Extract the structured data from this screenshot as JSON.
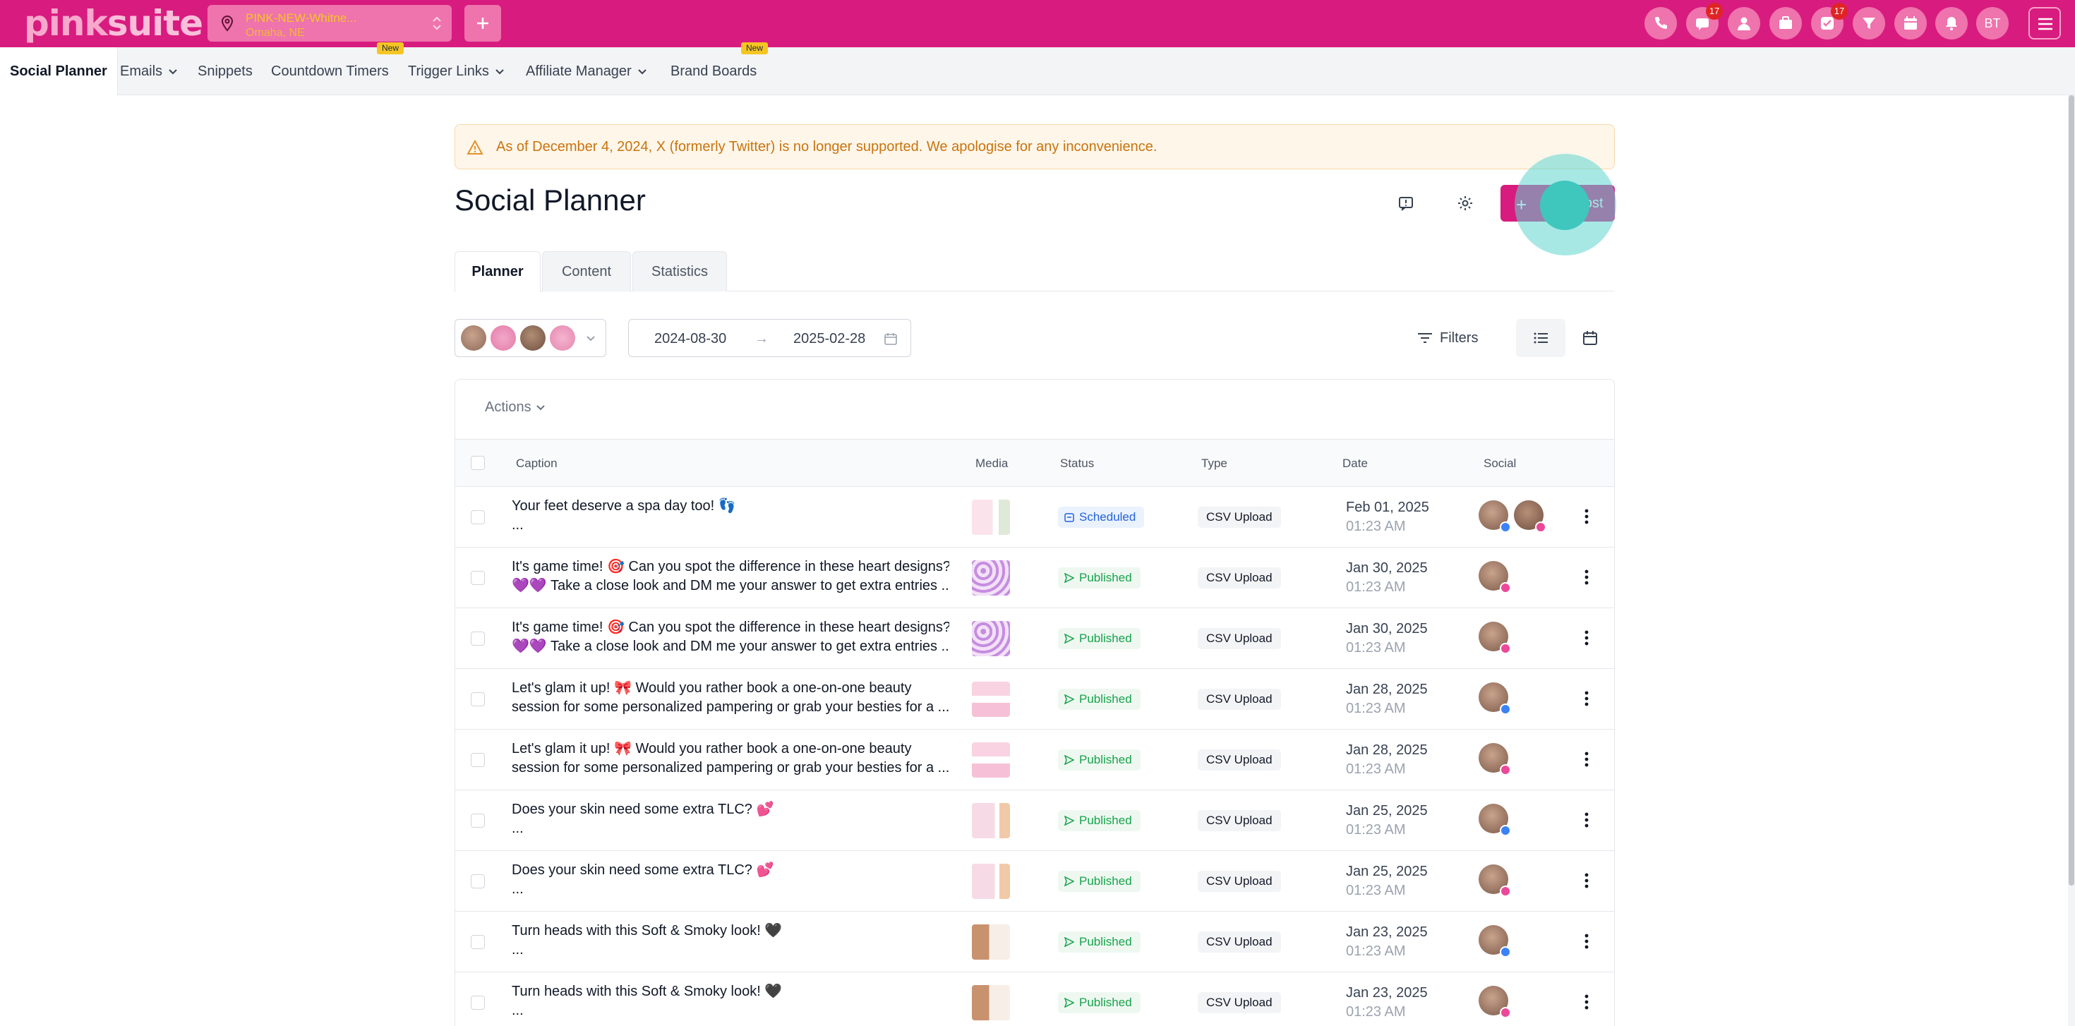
{
  "app": {
    "logo_pink": "pink",
    "logo_suite": "suite",
    "location_name": "PINK-NEW-Whitne...",
    "location_sub": "Omaha, NE",
    "user_initials": "BT",
    "notification_count_1": "17",
    "notification_count_2": "17"
  },
  "nav": {
    "items": [
      "Social Planner",
      "Emails",
      "Snippets",
      "Countdown Timers",
      "Trigger Links",
      "Affiliate Manager",
      "Brand Boards"
    ],
    "new_badge": "New"
  },
  "alert": {
    "text": "As of December 4, 2024, X (formerly Twitter) is no longer supported. We apologise for any inconvenience."
  },
  "header": {
    "title": "Social Planner",
    "new_post_plus": "+",
    "new_post_label": "New Post"
  },
  "tabs": [
    "Planner",
    "Content",
    "Statistics"
  ],
  "filters": {
    "date_from": "2024-08-30",
    "date_arrow": "→",
    "date_to": "2025-02-28",
    "filters_label": "Filters",
    "actions_label": "Actions"
  },
  "table": {
    "columns": [
      "Caption",
      "Media",
      "Status",
      "Type",
      "Date",
      "Social"
    ],
    "rows": [
      {
        "line1": "Your feet deserve a spa day too! 👣",
        "line2": "...",
        "status": "Scheduled",
        "type": "CSV Upload",
        "date": "Feb 01, 2025",
        "time": "01:23 AM"
      },
      {
        "line1": "It's game time! 🎯 Can you spot the difference in these heart designs?",
        "line2": "💜💜 Take a close look and DM me your answer to get extra entries ...",
        "status": "Published",
        "type": "CSV Upload",
        "date": "Jan 30, 2025",
        "time": "01:23 AM"
      },
      {
        "line1": "It's game time! 🎯 Can you spot the difference in these heart designs?",
        "line2": "💜💜 Take a close look and DM me your answer to get extra entries ...",
        "status": "Published",
        "type": "CSV Upload",
        "date": "Jan 30, 2025",
        "time": "01:23 AM"
      },
      {
        "line1": "Let's glam it up! 🎀 Would you rather book a one-on-one beauty",
        "line2": "session for some personalized pampering or grab your besties for a ...",
        "status": "Published",
        "type": "CSV Upload",
        "date": "Jan 28, 2025",
        "time": "01:23 AM"
      },
      {
        "line1": "Let's glam it up! 🎀 Would you rather book a one-on-one beauty",
        "line2": "session for some personalized pampering or grab your besties for a ...",
        "status": "Published",
        "type": "CSV Upload",
        "date": "Jan 28, 2025",
        "time": "01:23 AM"
      },
      {
        "line1": "Does your skin need some extra TLC? 💕",
        "line2": "...",
        "status": "Published",
        "type": "CSV Upload",
        "date": "Jan 25, 2025",
        "time": "01:23 AM"
      },
      {
        "line1": "Does your skin need some extra TLC? 💕",
        "line2": "...",
        "status": "Published",
        "type": "CSV Upload",
        "date": "Jan 25, 2025",
        "time": "01:23 AM"
      },
      {
        "line1": "Turn heads with this Soft & Smoky look! 🖤",
        "line2": "...",
        "status": "Published",
        "type": "CSV Upload",
        "date": "Jan 23, 2025",
        "time": "01:23 AM"
      },
      {
        "line1": "Turn heads with this Soft & Smoky look! 🖤",
        "line2": "...",
        "status": "Published",
        "type": "CSV Upload",
        "date": "Jan 23, 2025",
        "time": "01:23 AM"
      }
    ]
  },
  "colors": {
    "brand": "#d81b7f",
    "brand_light": "#ef73ac",
    "accent_yellow": "#f5c623",
    "published_green": "#17a34a",
    "scheduled_blue": "#2463d8",
    "highlight_teal": "#3fc7bd"
  },
  "icons": [
    "map-pin-icon",
    "plus-icon",
    "phone-icon",
    "chat-icon",
    "user-icon",
    "briefcase-icon",
    "check-icon",
    "filter-funnel-icon",
    "calendar-icon",
    "bell-icon",
    "menu-icon",
    "warning-icon",
    "feedback-icon",
    "gear-icon",
    "list-icon",
    "send-icon",
    "clock-icon",
    "kebab-icon"
  ]
}
